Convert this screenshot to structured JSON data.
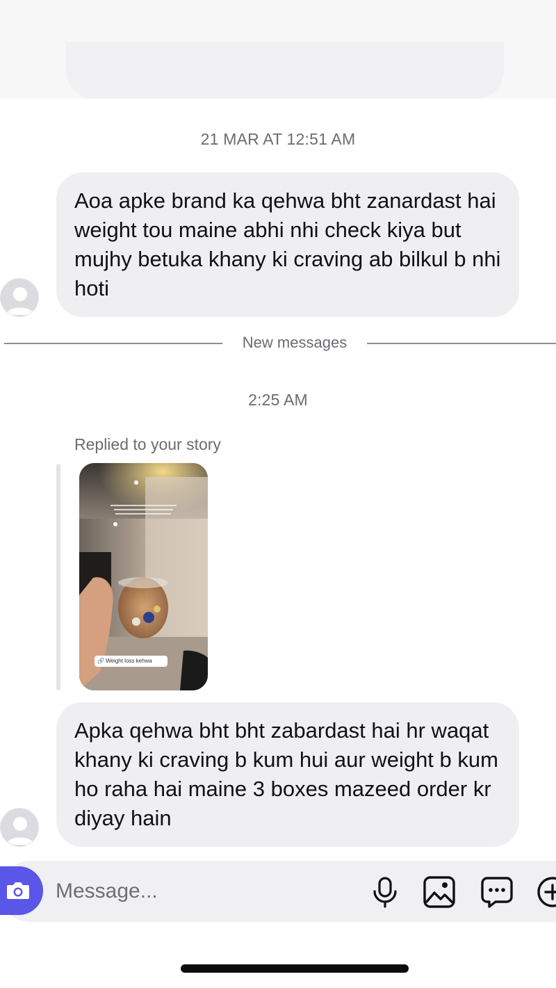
{
  "thread": {
    "timestamp_1": "21 MAR AT 12:51 AM",
    "message_1": "Aoa apke brand ka qehwa bht zanardast hai weight tou maine abhi nhi check kiya but mujhy betuka khany ki craving ab bilkul b nhi hoti",
    "new_messages_label": "New messages",
    "timestamp_2": "2:25 AM",
    "story_reply_label": "Replied to your story",
    "story_link_tag": "Weight loss kehwa",
    "message_2": "Apka qehwa  bht bht zabardast hai hr waqat khany ki craving b kum hui aur weight b kum ho raha hai maine 3 boxes mazeed order kr diyay hain"
  },
  "composer": {
    "placeholder": "Message..."
  },
  "icons": {
    "camera": "camera-icon",
    "mic": "microphone-icon",
    "gallery": "image-icon",
    "sticker": "sticker-chat-icon",
    "plus": "plus-circle-icon",
    "avatar": "default-avatar-icon"
  },
  "colors": {
    "accent": "#5a56e8",
    "bubble": "#efeff2",
    "meta_text": "#6b6b70"
  }
}
